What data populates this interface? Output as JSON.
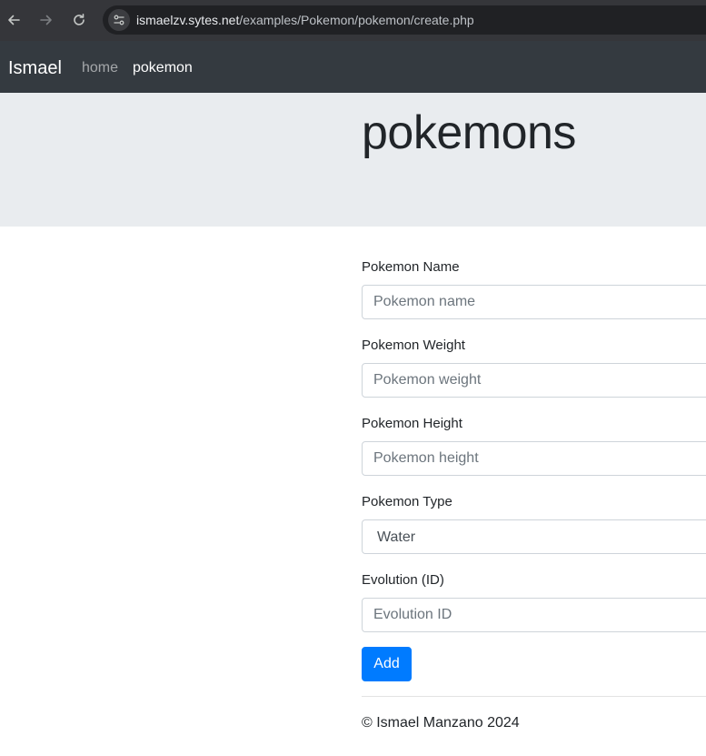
{
  "browser": {
    "url_host": "ismaelzv.sytes.net",
    "url_path": "/examples/Pokemon/pokemon/create.php"
  },
  "navbar": {
    "brand": "Ismael",
    "links": [
      {
        "label": "home"
      },
      {
        "label": "pokemon"
      }
    ]
  },
  "jumbotron": {
    "title": "pokemons"
  },
  "form": {
    "name_label": "Pokemon Name",
    "name_placeholder": "Pokemon name",
    "weight_label": "Pokemon Weight",
    "weight_placeholder": "Pokemon weight",
    "height_label": "Pokemon Height",
    "height_placeholder": "Pokemon height",
    "type_label": "Pokemon Type",
    "type_selected": "Water",
    "evolution_label": "Evolution (ID)",
    "evolution_placeholder": "Evolution ID",
    "submit_label": "Add"
  },
  "footer": {
    "text": "© Ismael Manzano 2024"
  },
  "colors": {
    "navbar": "#343a40",
    "jumbotron": "#e9ecef",
    "primary": "#007bff"
  }
}
